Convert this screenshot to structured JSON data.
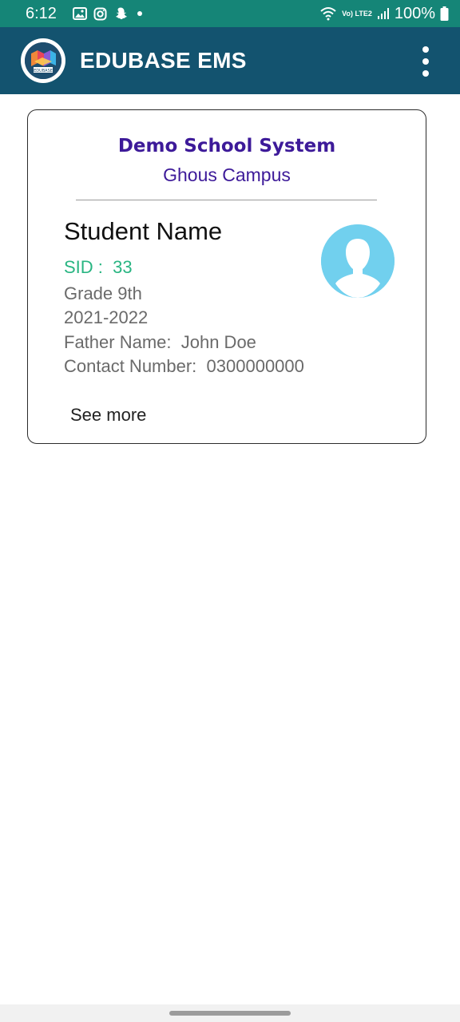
{
  "status_bar": {
    "time": "6:12",
    "battery": "100%",
    "network": "Vo) LTE2",
    "icons": [
      "gallery-icon",
      "instagram-icon",
      "snapchat-icon",
      "dot-icon",
      "wifi-icon",
      "signal-icon",
      "battery-icon"
    ]
  },
  "app_bar": {
    "title": "EDUBASE EMS",
    "logo_text": "EDUBASE",
    "menu_icon": "more-vertical-icon"
  },
  "card": {
    "school_name": "Demo School System",
    "campus": "Ghous Campus",
    "student_name": "Student Name",
    "sid_label": "SID :",
    "sid_value": "33",
    "grade": "Grade 9th",
    "session": "2021-2022",
    "father_label": "Father Name:",
    "father_value": "John Doe",
    "contact_label": "Contact Number:",
    "contact_value": "0300000000",
    "see_more": "See more",
    "avatar_icon": "person-avatar-icon"
  },
  "colors": {
    "status_bar": "#158577",
    "app_bar": "#13536F",
    "school_text": "#3D1A99",
    "sid_text": "#29B582",
    "avatar_bg": "#71D0EE"
  }
}
